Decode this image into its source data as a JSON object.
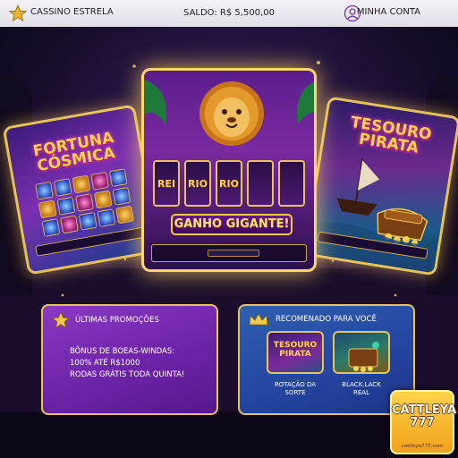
{
  "header": {
    "brand_label": "CASSINO ESTRELA",
    "balance_label": "SALDO: R$ 5,500,00",
    "account_label": "MINHA CONTA"
  },
  "games": {
    "left": {
      "title_line1": "FORTUNA",
      "title_line2": "CÓSMICA"
    },
    "center": {
      "reels": [
        "REI",
        "RIO",
        "RIO",
        "",
        ""
      ],
      "win_text": "GANHO GIGANTE!"
    },
    "right": {
      "title_line1": "TESOURO",
      "title_line2": "PIRATA"
    }
  },
  "promotions": {
    "title": "ÚLTIMAS PROMOÇÕES",
    "lines": [
      "BÔNUS DE BOEAS-WINDAS:",
      "100% ATÉ R$1000",
      "RODAS GRÁTIS TODA QUINTA!"
    ]
  },
  "recommended": {
    "title": "RECOMENADO PARA VOCÊ",
    "items": [
      {
        "art_line1": "TESOURO",
        "art_line2": "PIRATA",
        "label_line1": "ROTAÇÃO DA",
        "label_line2": "SORTE"
      },
      {
        "art_line1": "",
        "art_line2": "",
        "label_line1": "BLACK.LACK",
        "label_line2": "REAL"
      }
    ]
  },
  "logo": {
    "name": "CATTLEYA 777",
    "url": "cattleya777.com"
  },
  "colors": {
    "accent_gold": "#e9c25a",
    "promo_purple": "#6d24a8",
    "rec_blue": "#2444a0"
  },
  "icons": [
    "star-icon",
    "user-icon",
    "lion-icon",
    "crown-icon"
  ]
}
